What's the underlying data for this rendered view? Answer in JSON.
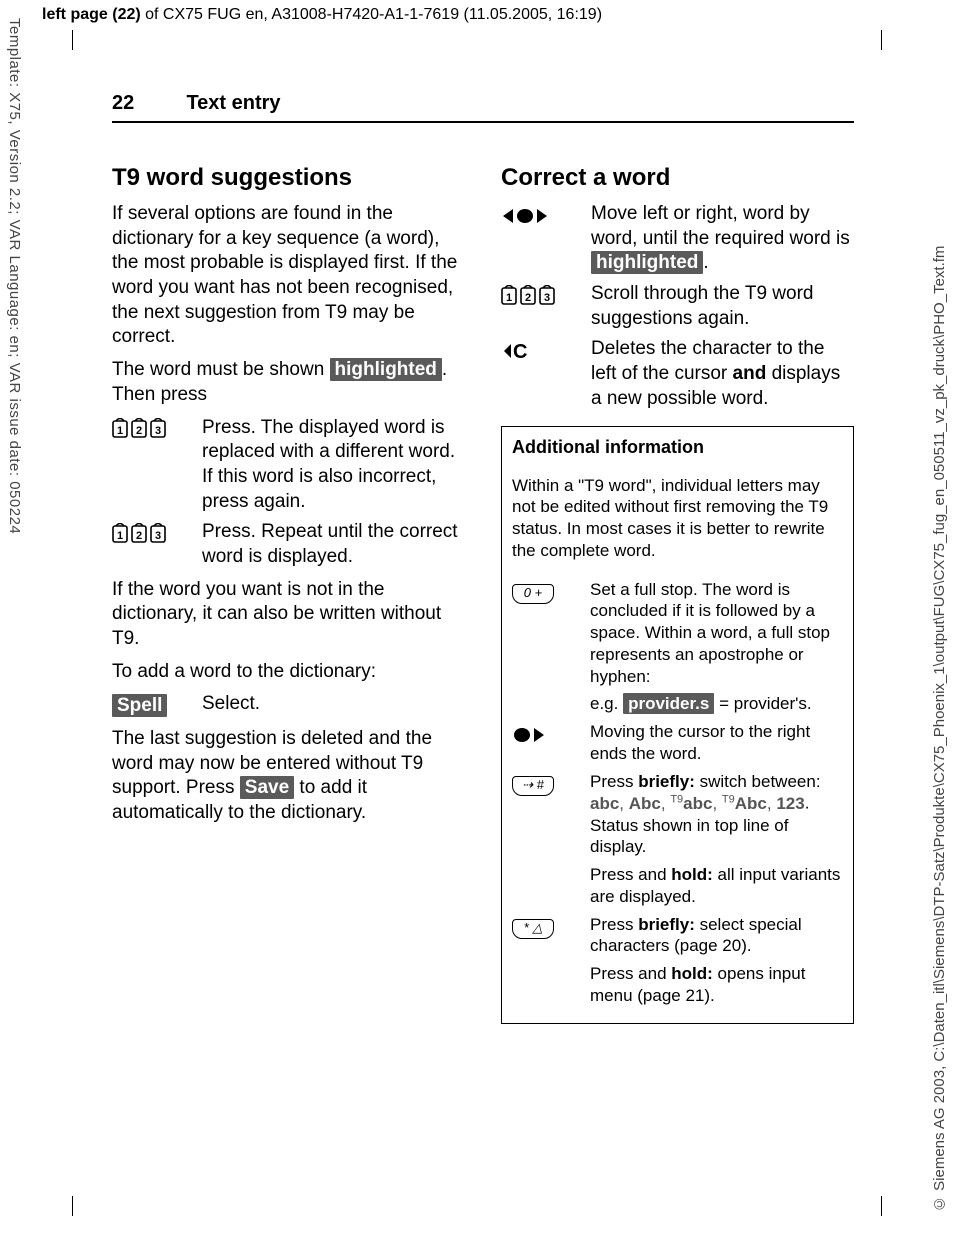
{
  "banner": {
    "prefix": "left page (22)",
    "rest": " of CX75 FUG en, A31008-H7420-A1-1-7619 (11.05.2005, 16:19)"
  },
  "left_margin_text": "Template: X75, Version 2.2; VAR Language: en; VAR issue date: 050224",
  "right_margin_text": "© Siemens AG 2003, C:\\Daten_itl\\Siemens\\DTP-Satz\\Produkte\\CX75_Phoenix_1\\output\\FUG\\CX75_fug_en_050511_vz_pk_druck\\PHO_Text.fm",
  "header": {
    "page_number": "22",
    "section": "Text entry"
  },
  "left_col": {
    "h_t9": "T9 word suggestions",
    "p_intro": "If several options are found in the dictionary for a key sequence (a word), the most probable is displayed first. If the word you want has not been recognised, the next suggestion from T9 may be correct.",
    "p_must_shown_pre": "The word must be shown ",
    "hl_highlighted": "highlighted",
    "p_must_shown_post": ". Then press",
    "row1_text": "Press. The displayed word is replaced with a different word. If this word is also incorrect, press again.",
    "row2_text": "Press. Repeat until the correct word is displayed.",
    "p_notindict": "If the word you want is not in the dictionary, it can also be written without T9.",
    "p_addword": "To add a word to the dictionary:",
    "spell_label": "Spell",
    "spell_text": "Select.",
    "p_lastsugg_pre": "The last suggestion is deleted and the word may now be entered without T9 support. Press ",
    "save_label": "Save",
    "p_lastsugg_post": " to add it automatically to the dictionary."
  },
  "right_col": {
    "h_correct": "Correct a word",
    "row_nav_text_pre": "Move left or right, word by word, until the required word is ",
    "hl_highlighted": "highlighted",
    "row_nav_text_post": ".",
    "row_t9_text": "Scroll through the T9 word suggestions again.",
    "row_del_pre": "Deletes the character to the left of the cursor ",
    "row_del_bold": "and",
    "row_del_post": " displays a new possible word.",
    "info": {
      "title": "Additional information",
      "p_within": "Within a \"T9 word\", individual letters may not be edited without first removing the T9 status. In most cases it is better to rewrite the complete word.",
      "key0_label": "0 +",
      "key0_text": "Set a full stop. The word is concluded if it is followed by a space. Within a word, a full stop represents an apostrophe or hyphen:",
      "eg_pre": "e.g. ",
      "eg_hl": "provider.s",
      "eg_post": " = provider's.",
      "cursor_text": "Moving the cursor to the right ends the word.",
      "hash_label": "⇢ #",
      "hash_brief_pre": "Press ",
      "hash_brief_bold": "briefly:",
      "hash_brief_post1": " switch between: ",
      "modes": "abc, Abc, T9abc, T9Abc, 123",
      "hash_brief_post2": ". Status shown in top line of display.",
      "hash_hold_pre": "Press and ",
      "hash_hold_bold": "hold:",
      "hash_hold_post": " all input variants are displayed.",
      "star_label": "* △",
      "star_brief_pre": "Press ",
      "star_brief_bold": "briefly:",
      "star_brief_post": " select special characters (page 20).",
      "star_hold_pre": "Press and ",
      "star_hold_bold": "hold:",
      "star_hold_post": " opens input menu (page 21)."
    }
  }
}
